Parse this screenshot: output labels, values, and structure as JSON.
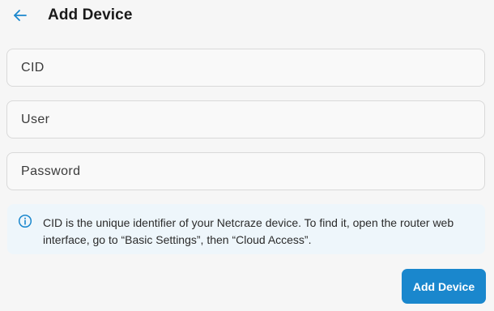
{
  "header": {
    "title": "Add Device",
    "back_icon": "arrow-left-icon"
  },
  "form": {
    "cid": {
      "placeholder": "CID",
      "value": ""
    },
    "user": {
      "placeholder": "User",
      "value": ""
    },
    "password": {
      "placeholder": "Password",
      "value": ""
    }
  },
  "info": {
    "icon": "info-icon",
    "text": "CID is the unique identifier of your Netcraze device. To find it, open the router web interface, go to “Basic Settings”, then “Cloud Access”."
  },
  "actions": {
    "submit_label": "Add Device"
  },
  "colors": {
    "accent": "#1a87cd",
    "info_background": "#eef6fb",
    "page_background": "#f6f6f6"
  }
}
